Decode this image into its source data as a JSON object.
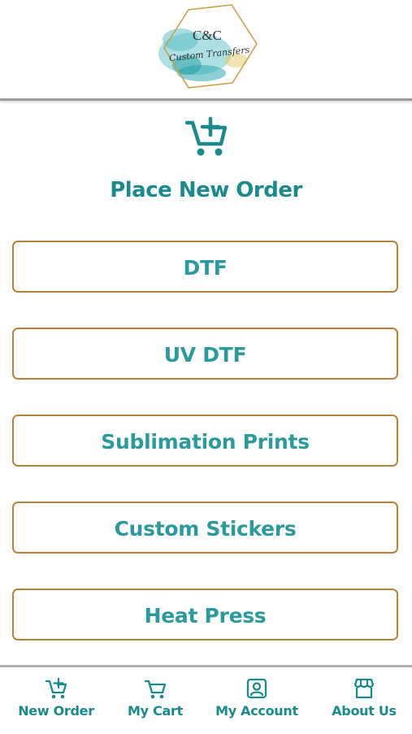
{
  "header": {
    "logo_text_line1": "C&C",
    "logo_text_line2": "Custom Transfers"
  },
  "icon": "cart-plus-icon",
  "page_title": "Place New Order",
  "buttons": [
    {
      "label": "DTF"
    },
    {
      "label": "UV DTF"
    },
    {
      "label": "Sublimation Prints"
    },
    {
      "label": "Custom Stickers"
    },
    {
      "label": "Heat Press"
    }
  ],
  "nav": [
    {
      "label": "New Order",
      "icon": "cart-plus-icon"
    },
    {
      "label": "My Cart",
      "icon": "cart-icon"
    },
    {
      "label": "My Account",
      "icon": "account-icon"
    },
    {
      "label": "About Us",
      "icon": "store-icon"
    }
  ],
  "colors": {
    "teal": "#1a8a8d",
    "button_text": "#2a9a9c",
    "gold_border": "#b5843a"
  }
}
